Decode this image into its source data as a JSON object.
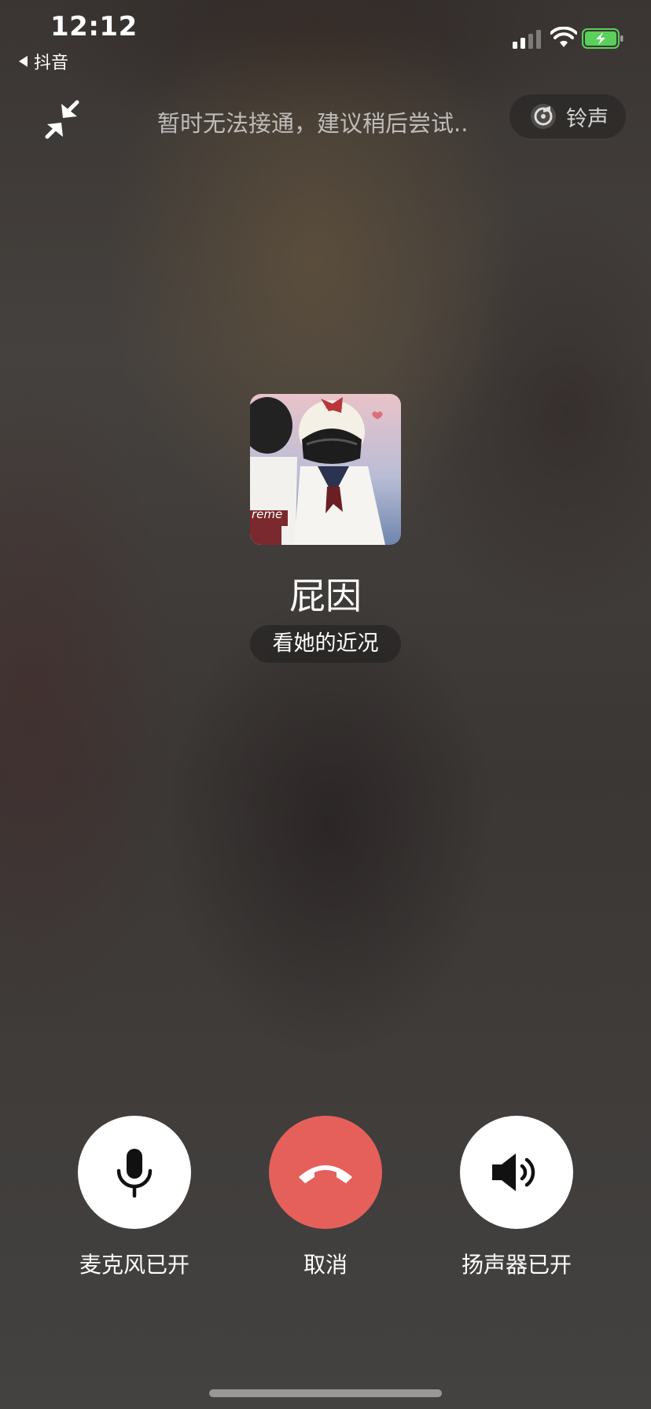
{
  "status_bar": {
    "time": "12:12",
    "back_app_label": "抖音",
    "battery_color": "#5ad05a"
  },
  "top": {
    "hint_text": "暂时无法接通，建议稍后尝试..",
    "ringtone_label": "铃声"
  },
  "callee": {
    "name": "屁因",
    "status_button_label": "看她的近况",
    "avatar_text": "reme"
  },
  "controls": {
    "mic_label": "麦克风已开",
    "hangup_label": "取消",
    "speaker_label": "扬声器已开",
    "hangup_color": "#e5605a"
  },
  "icons": [
    "back-triangle-icon",
    "signal-icon",
    "wifi-icon",
    "battery-charging-icon",
    "collapse-arrows-icon",
    "ringtone-icon",
    "microphone-icon",
    "hang-up-icon",
    "speaker-icon"
  ]
}
